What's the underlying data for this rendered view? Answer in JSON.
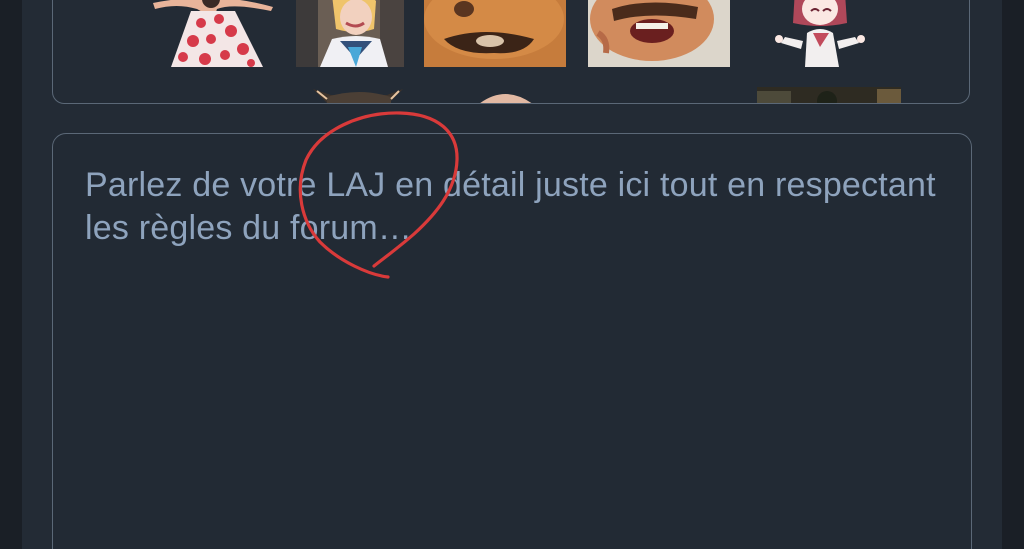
{
  "editor": {
    "placeholder": "Parlez de votre LAJ en détail juste ici tout en respectant les règles du forum…"
  },
  "stickers": {
    "row1": [
      {
        "icon": "dancing-girl-red-dress-sticker"
      },
      {
        "icon": "blonde-girl-sailor-sticker"
      },
      {
        "icon": "mustache-man-closeup-sticker"
      },
      {
        "icon": "crying-man-sticker"
      },
      {
        "icon": "anime-girl-shrug-sticker"
      }
    ],
    "row2": [
      {
        "icon": "cat-ears-sticker"
      },
      {
        "icon": "bald-head-sticker"
      },
      {
        "icon": "dark-photo-sticker"
      }
    ]
  },
  "annotation": {
    "color": "#d93a3a",
    "icon": "red-hand-drawn-circle"
  },
  "colors": {
    "background": "#232b35",
    "border": "#5b6877",
    "placeholder_text": "#8ea3bd"
  }
}
